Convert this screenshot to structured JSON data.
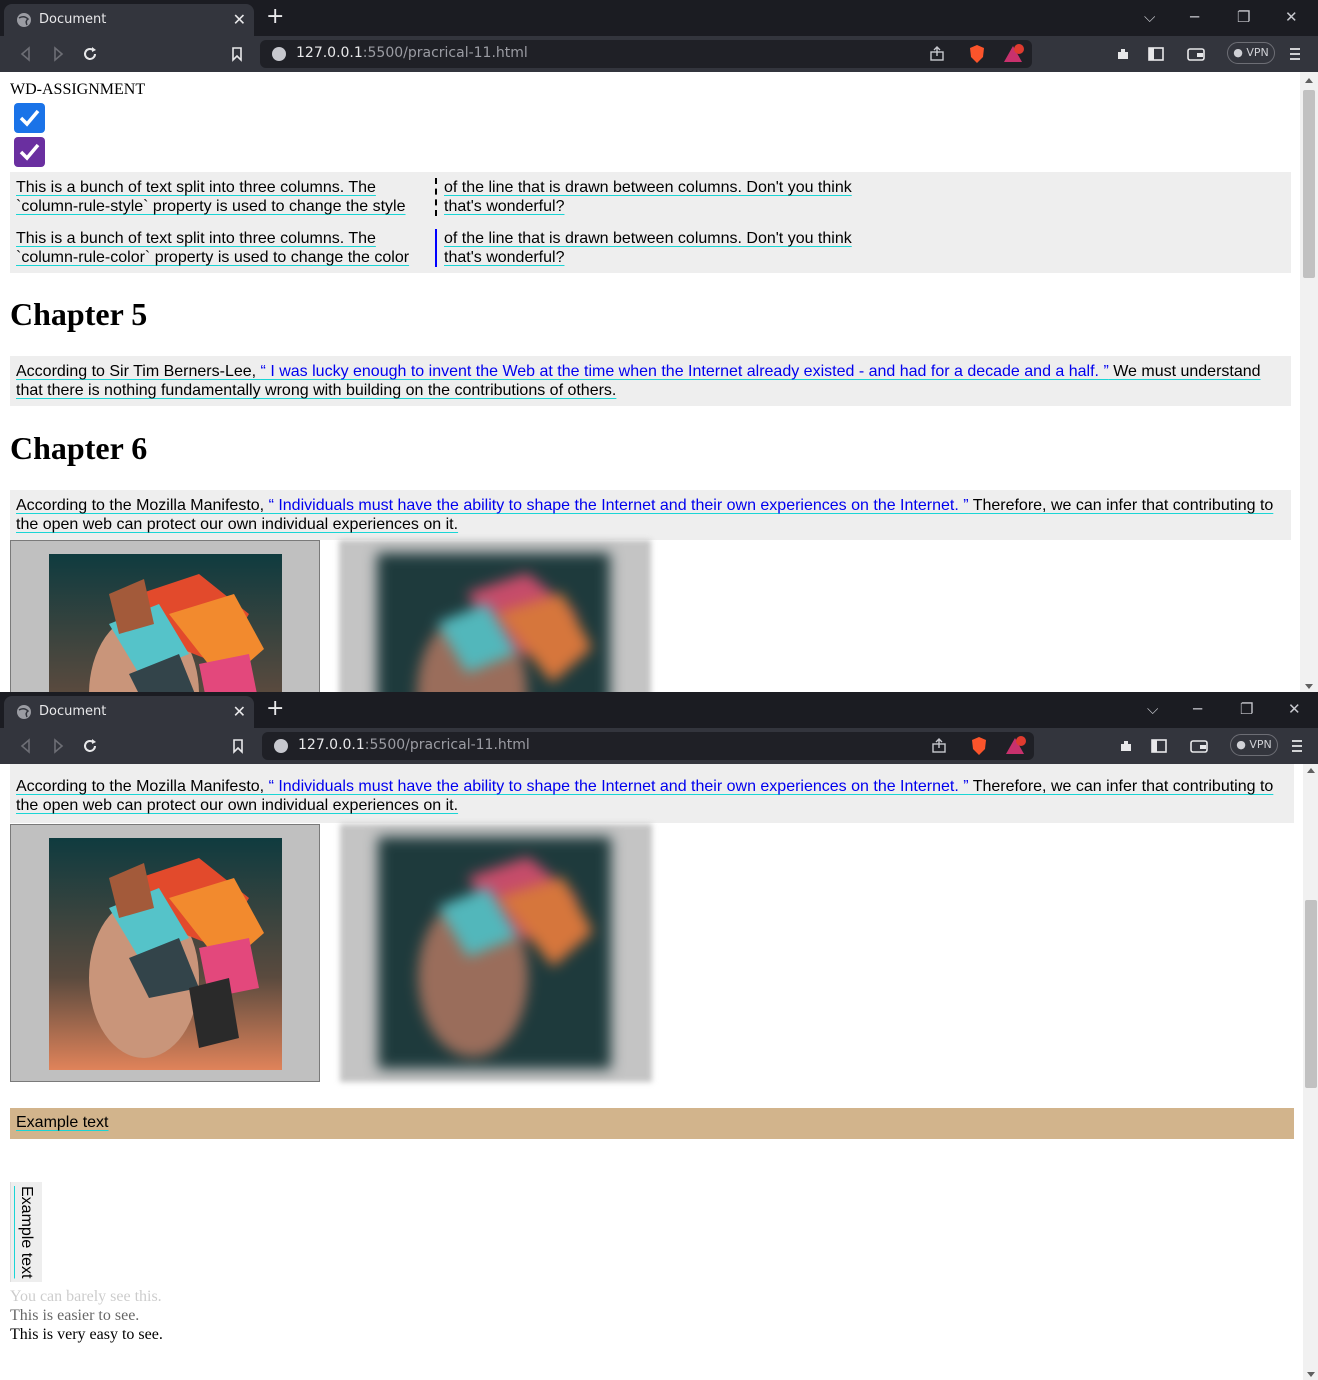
{
  "browser": {
    "tab_title": "Document",
    "tab_close": "✕",
    "new_tab": "+",
    "url_host": "127.0.0.1",
    "url_rest": ":5500/pracrical-11.html",
    "vpn_label": "VPN",
    "controls": {
      "chevron": "⌵",
      "minimize": "─",
      "restore": "❐",
      "close": "✕"
    },
    "icons": [
      "back-icon",
      "forward-icon",
      "reload-icon",
      "bookmark-icon",
      "share-icon",
      "brave-shield-icon",
      "brave-rewards-icon",
      "extensions-icon",
      "sidebar-icon",
      "wallet-icon",
      "menu-icon"
    ]
  },
  "page": {
    "site_title": "WD-ASSIGNMENT",
    "columns": [
      {
        "left": "This is a bunch of text split into three columns. The `column-rule-style` property is used to change the style",
        "right": "of the line that is drawn between columns. Don't you think that's wonderful?",
        "rule_color": "#000000",
        "rule_style": "dashed"
      },
      {
        "left": "This is a bunch of text split into three columns. The `column-rule-color` property is used to change the color",
        "right": "of the line that is drawn between columns. Don't you think that's wonderful?",
        "rule_color": "#0000ff",
        "rule_style": "solid"
      }
    ],
    "chapter5": {
      "heading": "Chapter 5",
      "before": "According to Sir Tim Berners-Lee, ",
      "quote": "“ I was lucky enough to invent the Web at the time when the Internet already existed - and had for a decade and a half. ”",
      "after": " We must understand that there is nothing fundamentally wrong with building on the contributions of others."
    },
    "chapter6": {
      "heading": "Chapter 6",
      "before": "According to the Mozilla Manifesto, ",
      "quote": "“ Individuals must have the ability to shape the Internet and their own experiences on the Internet. ”",
      "after": " Therefore, we can infer that contributing to the open web can protect our own individual experiences on it."
    },
    "example_text": "Example text",
    "vertical_text": "Example text",
    "opacity_lines": [
      "You can barely see this.",
      "This is easier to see.",
      "This is very easy to see."
    ]
  },
  "colors": {
    "checkbox_blue": "#1a73e8",
    "checkbox_purple": "#6a2fa0",
    "link_blue": "#0000ee",
    "example_bar": "#d2b48c",
    "gray_box": "#eeeeee"
  }
}
